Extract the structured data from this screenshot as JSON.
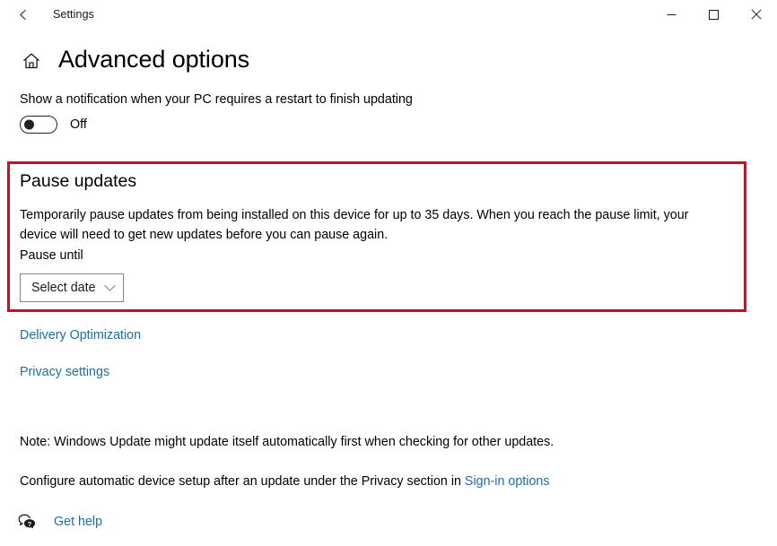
{
  "window": {
    "title": "Settings",
    "back_icon": "back-arrow-icon",
    "controls": [
      {
        "name": "minimize",
        "glyph": "—"
      },
      {
        "name": "maximize",
        "glyph": "□"
      },
      {
        "name": "close",
        "glyph": "✕"
      }
    ]
  },
  "header": {
    "home_icon": "home-icon",
    "title": "Advanced options"
  },
  "notification": {
    "description": "Show a notification when your PC requires a restart to finish updating",
    "toggle_state": "Off"
  },
  "pause_updates": {
    "section_title": "Pause updates",
    "description": "Temporarily pause updates from being installed on this device for up to 35 days. When you reach the pause limit, your device will need to get new updates before you can pause again.",
    "field_label": "Pause until",
    "dropdown_value": "Select date",
    "dropdown_icon": "chevron-down-icon",
    "highlight_color": "#C01327"
  },
  "links": {
    "delivery_optimization": "Delivery Optimization",
    "privacy_settings": "Privacy settings",
    "link_color": "#1d6fa5"
  },
  "notes": {
    "note_1": "Note: Windows Update might update itself automatically first when checking for other updates.",
    "note_2_prefix": "Configure automatic device setup after an update under the Privacy section in ",
    "note_2_link": "Sign-in options"
  },
  "get_help": {
    "icon": "help-chat-icon",
    "label": "Get help"
  }
}
